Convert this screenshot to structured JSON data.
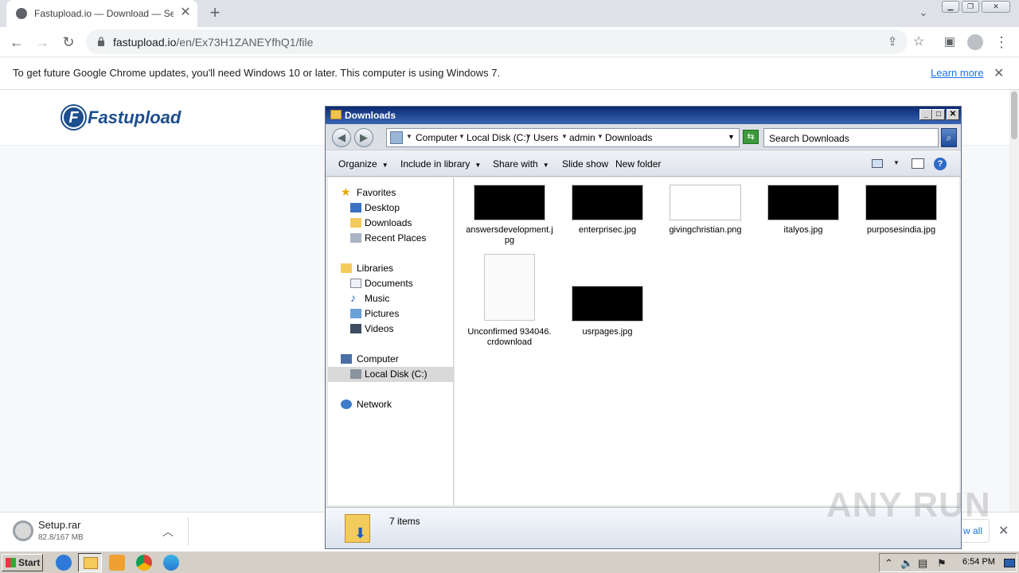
{
  "browser": {
    "tab_title": "Fastupload.io — Download — Setup",
    "url_host": "fastupload.io",
    "url_path": "/en/Ex73H1ZANEYfhQ1/file",
    "infobar_text": "To get future Google Chrome updates, you'll need Windows 10 or later. This computer is using Windows 7.",
    "learn_more": "Learn more"
  },
  "site": {
    "logo_letter": "F",
    "logo_text": "Fastupload"
  },
  "download": {
    "name": "Setup.rar",
    "size": "82.8/167 MB",
    "show_all": "w all"
  },
  "explorer": {
    "title": "Downloads",
    "breadcrumb": [
      "Computer",
      "Local Disk (C:)",
      "Users",
      "admin",
      "Downloads"
    ],
    "search_placeholder": "Search Downloads",
    "commands": [
      "Organize",
      "Include in library",
      "Share with",
      "Slide show",
      "New folder"
    ],
    "nav": {
      "favorites": "Favorites",
      "desktop": "Desktop",
      "downloads": "Downloads",
      "recent": "Recent Places",
      "libraries": "Libraries",
      "documents": "Documents",
      "music": "Music",
      "pictures": "Pictures",
      "videos": "Videos",
      "computer": "Computer",
      "local_disk": "Local Disk (C:)",
      "network": "Network"
    },
    "files": [
      {
        "name": "answersdevelopment.jpg"
      },
      {
        "name": "enterprisec.jpg"
      },
      {
        "name": "givingchristian.png"
      },
      {
        "name": "italyos.jpg"
      },
      {
        "name": "purposesindia.jpg"
      },
      {
        "name": "Unconfirmed 934046.crdownload"
      },
      {
        "name": "usrpages.jpg"
      }
    ],
    "status": "7 items"
  },
  "taskbar": {
    "start": "Start",
    "clock": "6:54 PM"
  },
  "watermark": "ANY RUN"
}
